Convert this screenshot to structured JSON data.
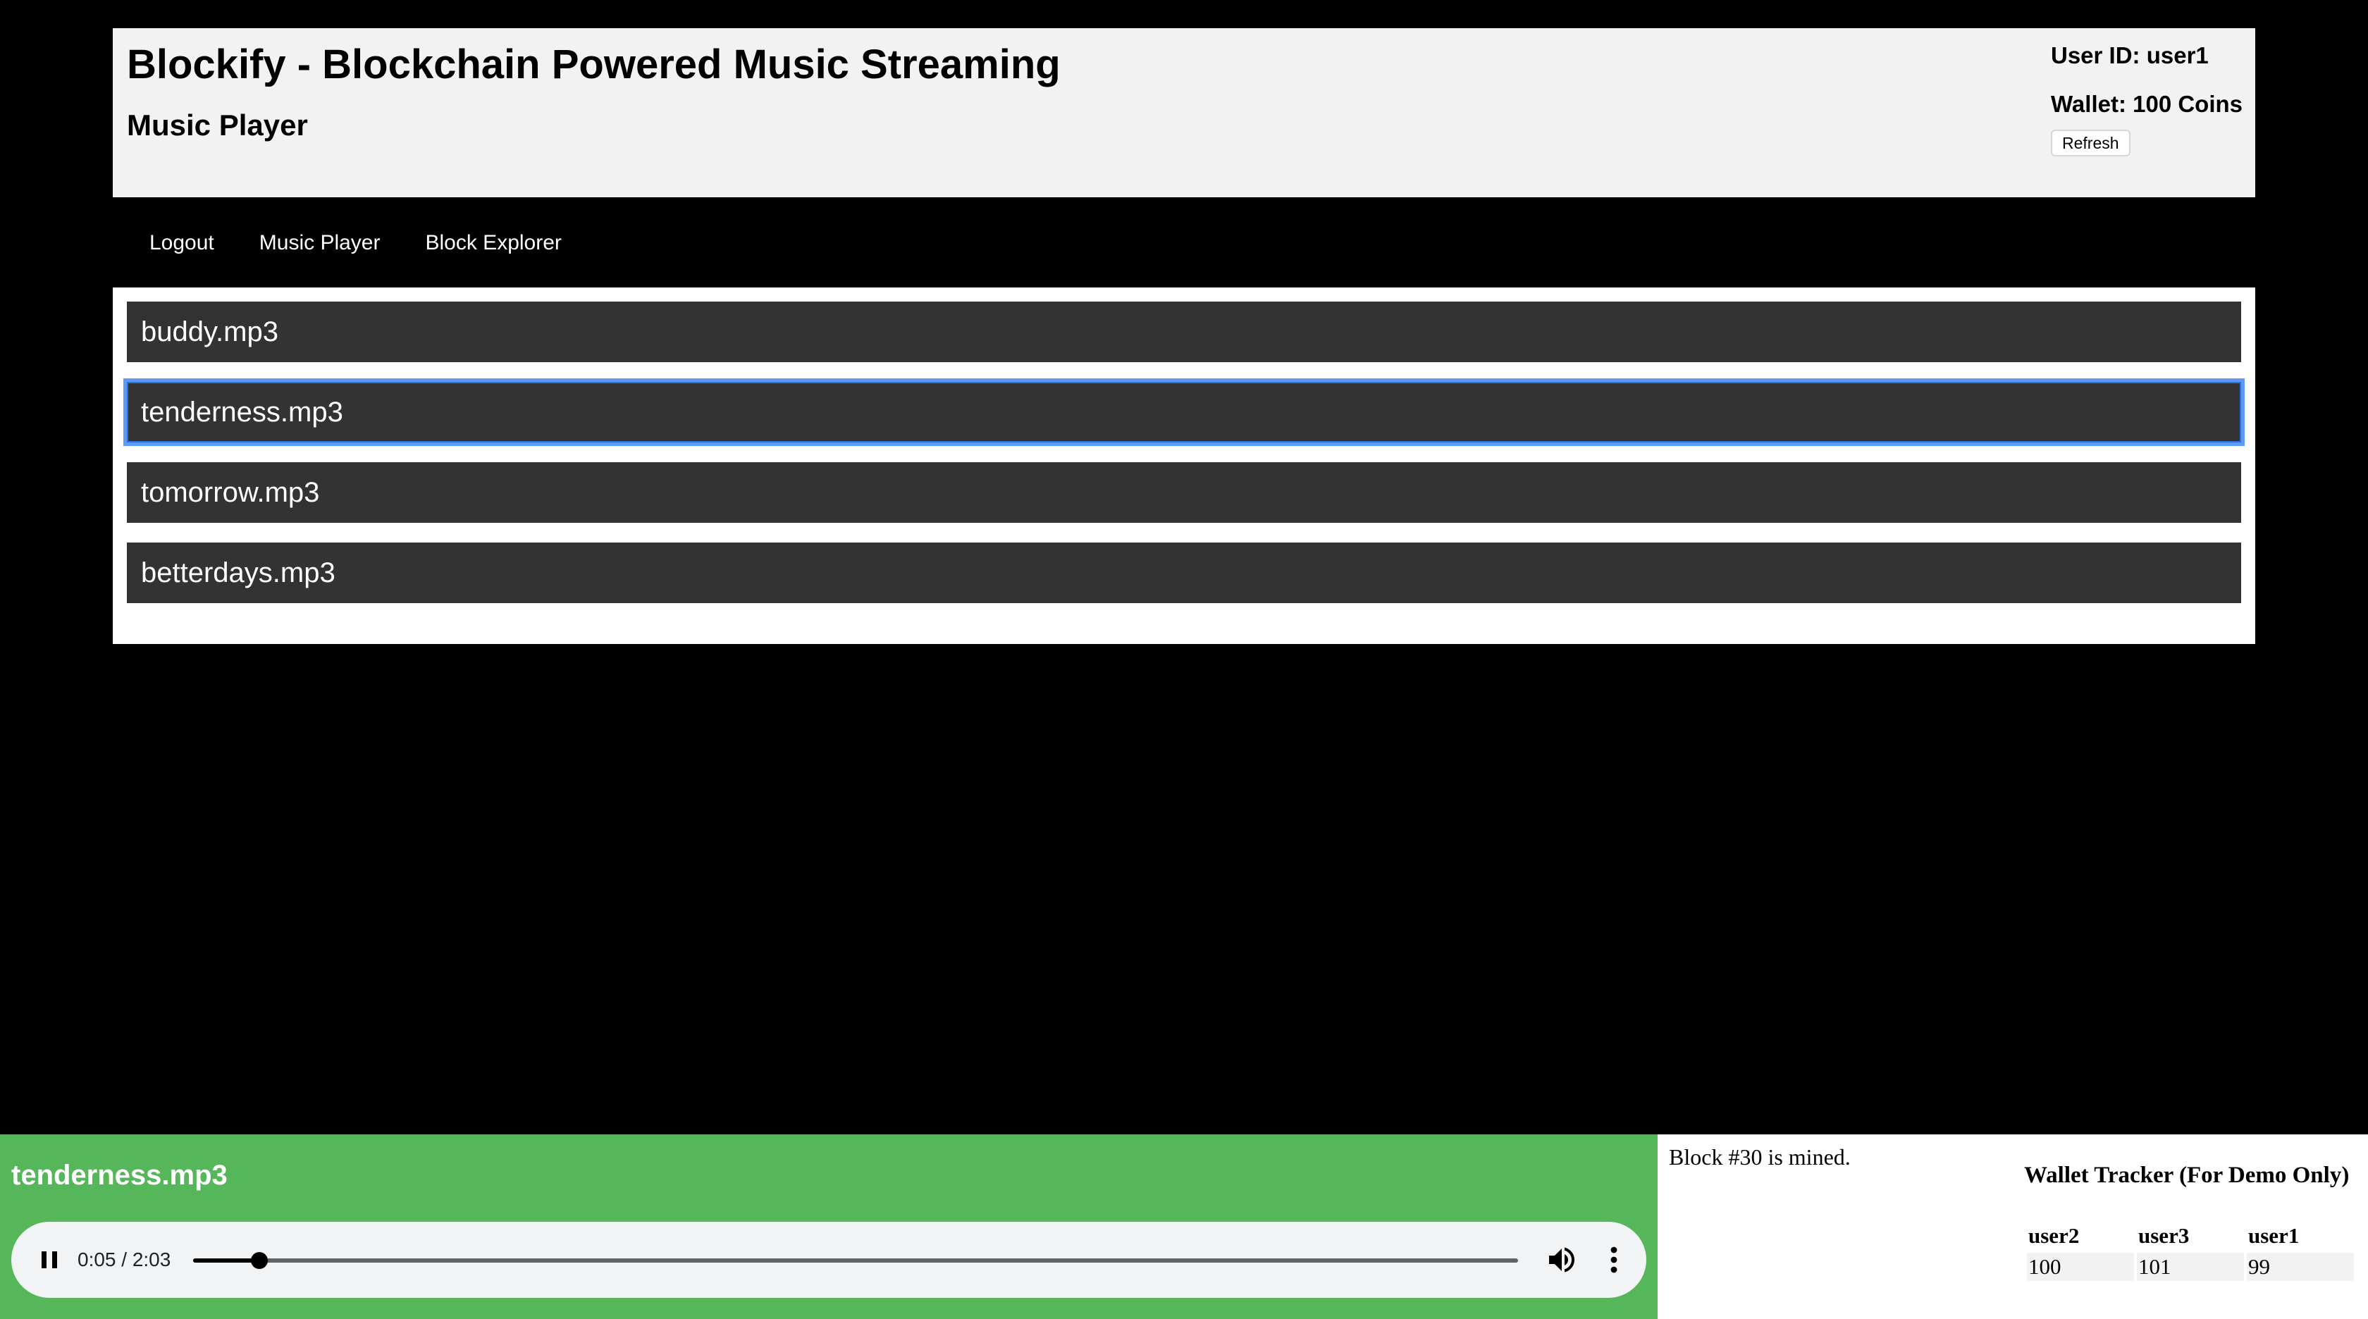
{
  "header": {
    "app_title": "Blockify - Blockchain Powered Music Streaming",
    "page_title": "Music Player",
    "user_id": "User ID: user1",
    "wallet": "Wallet: 100 Coins",
    "refresh_label": "Refresh"
  },
  "nav": {
    "items": [
      {
        "label": "Logout"
      },
      {
        "label": "Music Player"
      },
      {
        "label": "Block Explorer"
      }
    ]
  },
  "songs": [
    {
      "name": "buddy.mp3",
      "selected": false
    },
    {
      "name": "tenderness.mp3",
      "selected": true
    },
    {
      "name": "tomorrow.mp3",
      "selected": false
    },
    {
      "name": "betterdays.mp3",
      "selected": false
    }
  ],
  "player": {
    "now_playing": "tenderness.mp3",
    "time_display": "0:05 / 2:03",
    "progress_fraction": 0.05,
    "state": "playing",
    "icons": {
      "pause": "pause-icon",
      "volume": "volume-icon",
      "more": "more-vert-icon"
    }
  },
  "status": {
    "mined_message": "Block #30 is mined.",
    "tracker_title": "Wallet Tracker (For Demo Only)",
    "wallet_table": {
      "headers": [
        "user2",
        "user3",
        "user1"
      ],
      "values": [
        "100",
        "101",
        "99"
      ]
    }
  },
  "colors": {
    "background": "#000000",
    "header_bg": "#f2f2f2",
    "song_bg": "#333333",
    "selected_outline": "#5b9bf7",
    "player_bg": "#56b65a",
    "audio_bg": "#f1f3f4"
  }
}
